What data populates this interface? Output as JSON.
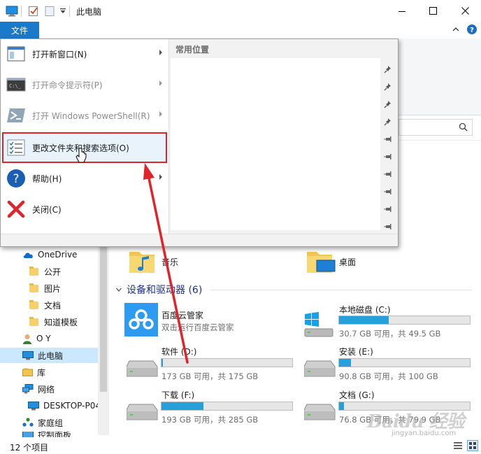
{
  "window": {
    "title": "此电脑",
    "colors": {
      "accent": "#1979ca",
      "selection": "#cce8ff",
      "highlight_box": "#e2232a",
      "progress": "#26a0da"
    }
  },
  "file_tab": {
    "label": "文件"
  },
  "file_menu": {
    "items": [
      {
        "label": "打开新窗口(N)",
        "icon": "new-window-icon",
        "submenu": true,
        "enabled": true
      },
      {
        "label": "打开命令提示符(P)",
        "icon": "cmd-prompt-icon",
        "submenu": true,
        "enabled": false
      },
      {
        "label": "打开 Windows PowerShell(R)",
        "icon": "powershell-icon",
        "submenu": true,
        "enabled": false
      },
      {
        "label": "更改文件夹和搜索选项(O)",
        "icon": "folder-options-icon",
        "submenu": false,
        "enabled": true,
        "highlighted": true
      },
      {
        "label": "帮助(H)",
        "icon": "help-icon",
        "submenu": true,
        "enabled": true
      },
      {
        "label": "关闭(C)",
        "icon": "close-icon",
        "submenu": false,
        "enabled": true
      }
    ],
    "frequent_header": "常用位置"
  },
  "nav_pane": {
    "items": [
      {
        "label": "OneDrive",
        "icon": "cloud-icon"
      },
      {
        "label": "公开",
        "icon": "folder-icon"
      },
      {
        "label": "图片",
        "icon": "folder-icon"
      },
      {
        "label": "文档",
        "icon": "folder-icon"
      },
      {
        "label": "知道模板",
        "icon": "folder-icon"
      },
      {
        "label": "O Y",
        "icon": "user-icon"
      },
      {
        "label": "此电脑",
        "icon": "computer-icon",
        "selected": true
      },
      {
        "label": "库",
        "icon": "library-icon"
      },
      {
        "label": "网络",
        "icon": "network-icon"
      },
      {
        "label": "DESKTOP-P04",
        "icon": "computer-icon"
      },
      {
        "label": "家庭组",
        "icon": "homegroup-icon"
      },
      {
        "label": "控制面板",
        "icon": "control-panel-icon"
      }
    ]
  },
  "folders": [
    {
      "label": "音乐",
      "icon": "music-folder-icon"
    },
    {
      "label": "桌面",
      "icon": "desktop-folder-icon"
    }
  ],
  "devices_section": {
    "label": "设备和驱动器 (6)"
  },
  "devices": [
    {
      "name": "百度云管家",
      "sub": "双击运行百度云管家",
      "icon": "baidu-cloud-icon"
    },
    {
      "name": "本地磁盘 (C:)",
      "sub": "30.7 GB 可用，共 49.5 GB",
      "used_fraction": 0.38,
      "icon": "windows-drive-icon"
    },
    {
      "name": "软件 (D:)",
      "sub": "173 GB 可用，共 175 GB",
      "used_fraction": 0.01,
      "icon": "drive-icon"
    },
    {
      "name": "安装 (E:)",
      "sub": "90.8 GB 可用，共 100 GB",
      "used_fraction": 0.09,
      "icon": "drive-icon"
    },
    {
      "name": "下载 (F:)",
      "sub": "193 GB 可用，共 285 GB",
      "used_fraction": 0.32,
      "icon": "drive-icon"
    },
    {
      "name": "文档 (G:)",
      "sub": "76.8 GB 可用，共 79.9 GB",
      "used_fraction": 0.04,
      "icon": "drive-icon"
    }
  ],
  "status_bar": {
    "item_count": "12 个项目"
  },
  "watermark": {
    "text": "Baidu 经验",
    "sub": "jingyan.baidu.com"
  }
}
